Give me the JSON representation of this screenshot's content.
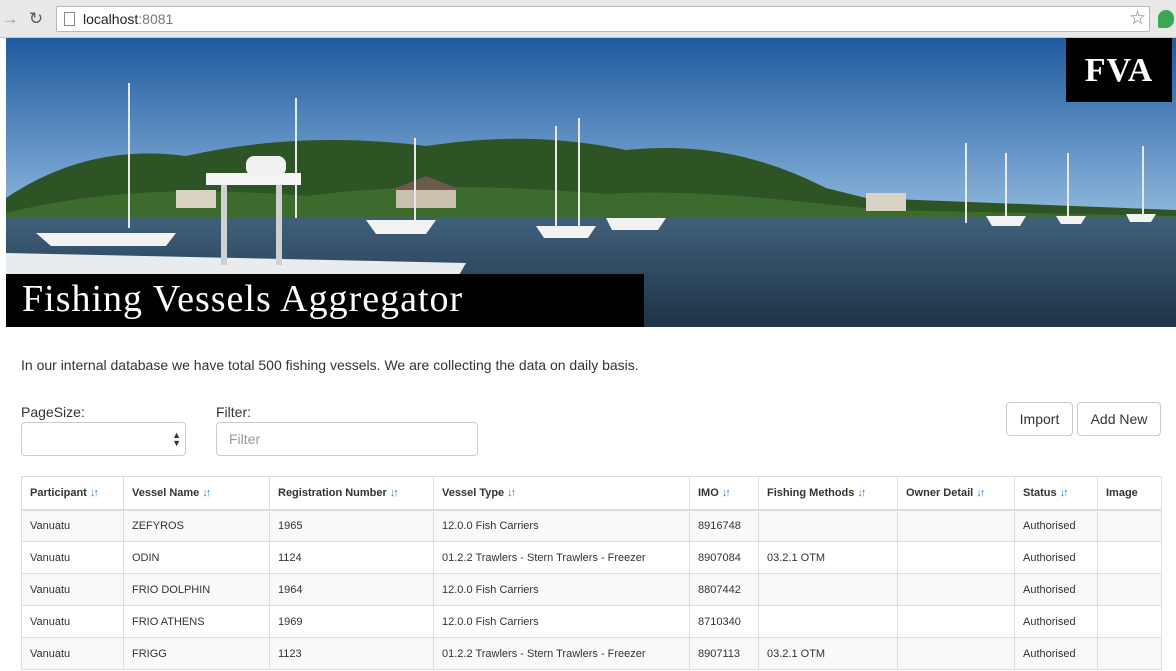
{
  "browser": {
    "url_host": "localhost",
    "url_port": ":8081"
  },
  "banner": {
    "logo": "FVA",
    "title": "Fishing Vessels Aggregator"
  },
  "intro_text": "In our internal database we have total 500 fishing vessels. We are collecting the data on daily basis.",
  "controls": {
    "pagesize_label": "PageSize:",
    "pagesize_value": "",
    "filter_label": "Filter:",
    "filter_placeholder": "Filter",
    "import_label": "Import",
    "add_new_label": "Add New"
  },
  "table": {
    "columns": [
      {
        "label": "Participant",
        "sortable": true
      },
      {
        "label": "Vessel Name",
        "sortable": true
      },
      {
        "label": "Registration Number",
        "sortable": true
      },
      {
        "label": "Vessel Type",
        "sortable": true
      },
      {
        "label": "IMO",
        "sortable": true
      },
      {
        "label": "Fishing Methods",
        "sortable": true
      },
      {
        "label": "Owner Detail",
        "sortable": true
      },
      {
        "label": "Status",
        "sortable": true
      },
      {
        "label": "Image",
        "sortable": false
      }
    ],
    "rows": [
      [
        "Vanuatu",
        "ZEFYROS",
        "1965",
        "12.0.0 Fish Carriers",
        "8916748",
        "",
        "",
        "Authorised",
        ""
      ],
      [
        "Vanuatu",
        "ODIN",
        "1124",
        "01.2.2 Trawlers - Stern Trawlers - Freezer",
        "8907084",
        "03.2.1 OTM",
        "",
        "Authorised",
        ""
      ],
      [
        "Vanuatu",
        "FRIO DOLPHIN",
        "1964",
        "12.0.0 Fish Carriers",
        "8807442",
        "",
        "",
        "Authorised",
        ""
      ],
      [
        "Vanuatu",
        "FRIO ATHENS",
        "1969",
        "12.0.0 Fish Carriers",
        "8710340",
        "",
        "",
        "Authorised",
        ""
      ],
      [
        "Vanuatu",
        "FRIGG",
        "1123",
        "01.2.2 Trawlers - Stern Trawlers - Freezer",
        "8907113",
        "03.2.1 OTM",
        "",
        "Authorised",
        ""
      ]
    ]
  },
  "colors": {
    "sort_icon": "#2d7ccf",
    "banner_text_bg": "#000000"
  }
}
